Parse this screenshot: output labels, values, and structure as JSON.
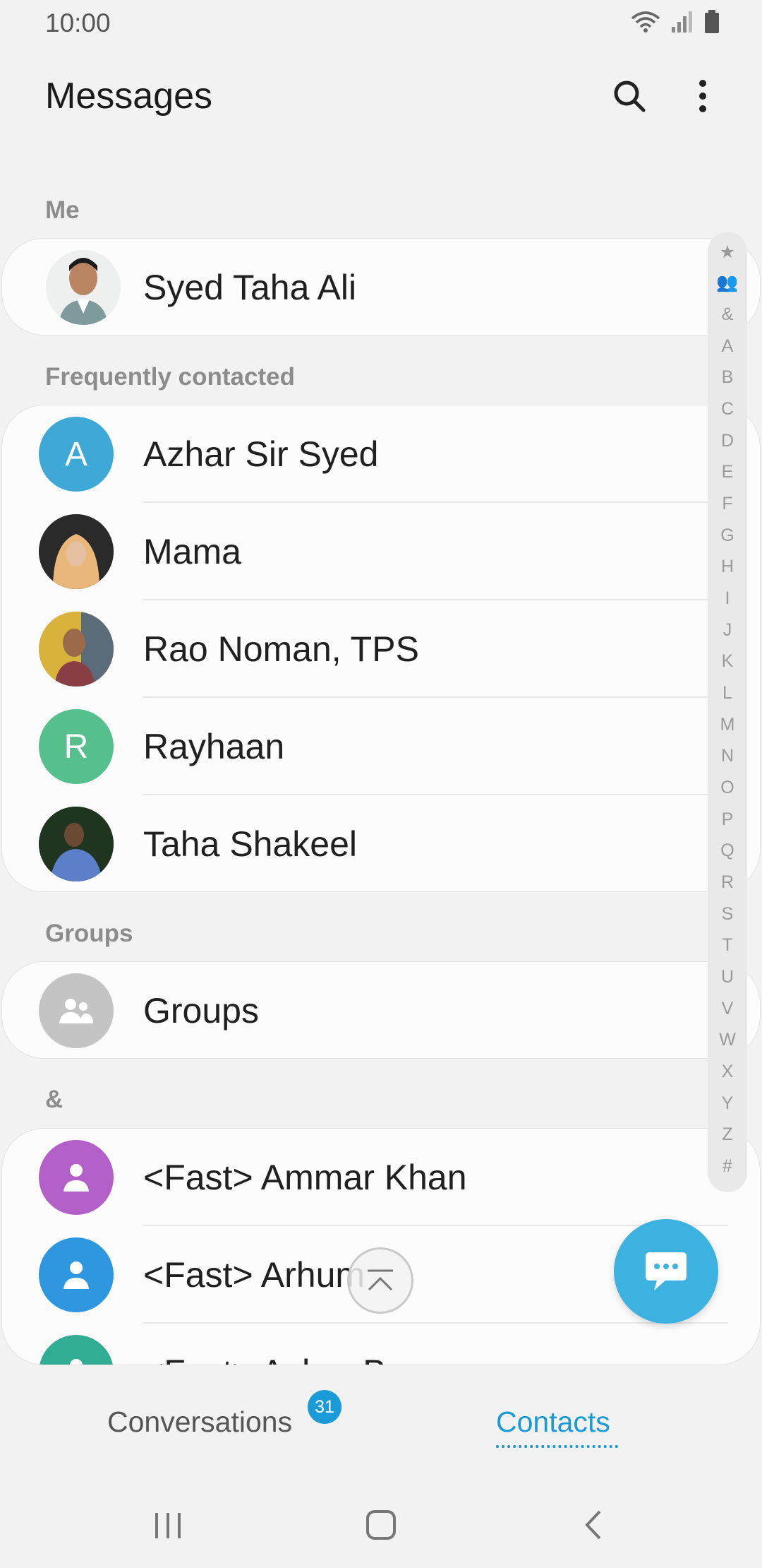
{
  "status": {
    "time": "10:00"
  },
  "app": {
    "title": "Messages"
  },
  "sections": {
    "me": "Me",
    "frequent": "Frequently contacted",
    "groups": "Groups",
    "amp": "&"
  },
  "me": {
    "name": "Syed Taha Ali"
  },
  "frequent": [
    {
      "name": "Azhar Sir Syed",
      "initial": "A",
      "color": "#3ea8d6"
    },
    {
      "name": "Mama",
      "initial": "",
      "color": "#6b4a3a"
    },
    {
      "name": "Rao Noman, TPS",
      "initial": "",
      "color": "#c5a13a"
    },
    {
      "name": "Rayhaan",
      "initial": "R",
      "color": "#55c08e"
    },
    {
      "name": "Taha Shakeel",
      "initial": "",
      "color": "#2e4a2a"
    }
  ],
  "groups_row": {
    "name": "Groups"
  },
  "amp_contacts": [
    {
      "name": "<Fast> Ammar Khan",
      "color": "#b35fc8"
    },
    {
      "name": "<Fast> Arhum",
      "color": "#2f96e0"
    },
    {
      "name": "<Fast> Asbar Burney",
      "color": "#31ad94"
    }
  ],
  "index": [
    "★",
    "👥",
    "&",
    "A",
    "B",
    "C",
    "D",
    "E",
    "F",
    "G",
    "H",
    "I",
    "J",
    "K",
    "L",
    "M",
    "N",
    "O",
    "P",
    "Q",
    "R",
    "S",
    "T",
    "U",
    "V",
    "W",
    "X",
    "Y",
    "Z",
    "#"
  ],
  "tabs": {
    "conversations": "Conversations",
    "conversations_badge": "31",
    "contacts": "Contacts"
  },
  "colors": {
    "accent": "#1a9ad6",
    "fab": "#3db1df"
  }
}
